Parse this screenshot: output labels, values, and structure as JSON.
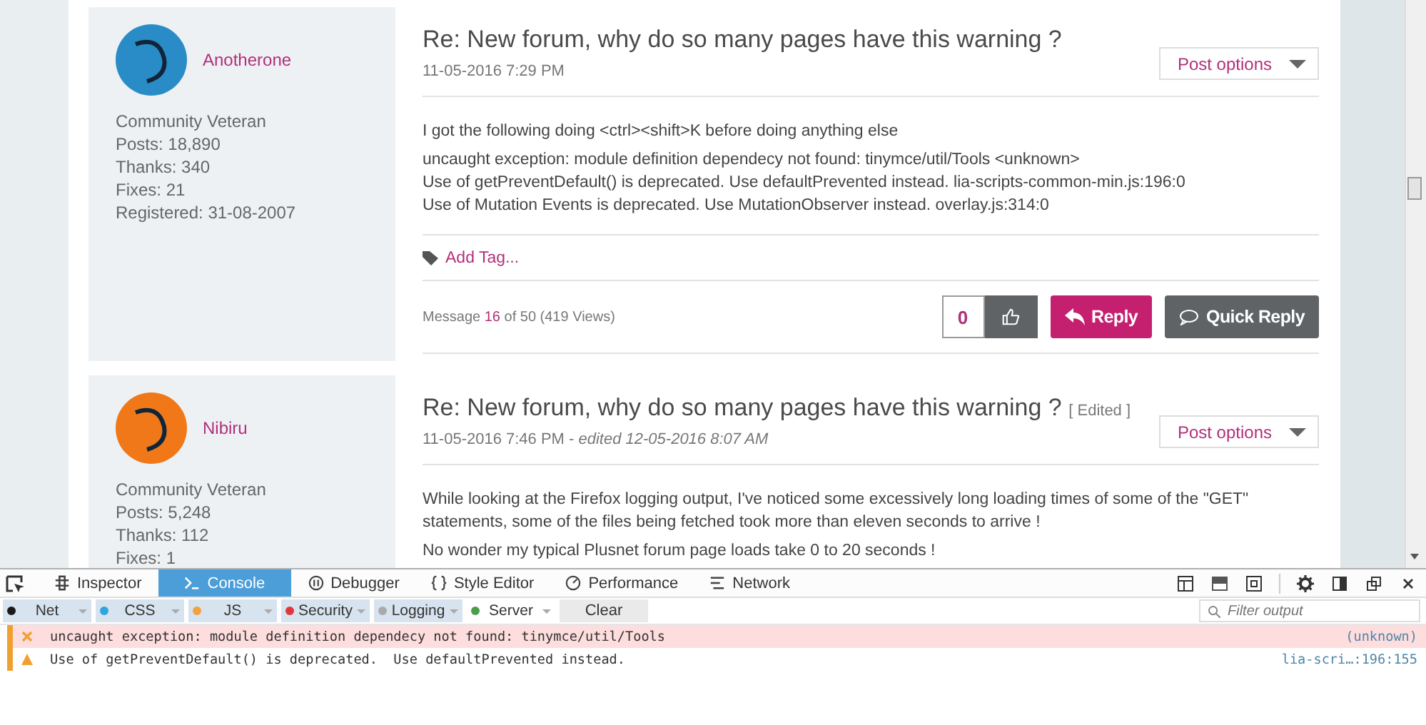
{
  "posts": [
    {
      "author": "Anotherone",
      "avatar": {
        "color": "#2a8cc6"
      },
      "rank": "Community Veteran",
      "stats": [
        "Posts: 18,890",
        "Thanks: 340",
        "Fixes: 21",
        "Registered: 31-08-2007"
      ],
      "title": "Re: New forum, why do so many pages have this warning ?",
      "date": "11-05-2016 7:29 PM",
      "options": "Post options",
      "body": [
        "I got the following doing <ctrl><shift>K before doing anything else",
        "uncaught exception: module definition dependecy not found: tinymce/util/Tools <unknown>\nUse of getPreventDefault() is deprecated. Use defaultPrevented instead. lia-scripts-common-min.js:196:0\nUse of Mutation Events is deprecated. Use MutationObserver instead. overlay.js:314:0"
      ],
      "tag_link": "Add Tag...",
      "message": {
        "prefix": "Message",
        "number": "16",
        "suffix": "of 50 (419 Views)"
      },
      "kudos": "0",
      "reply": "Reply",
      "quick_reply": "Quick Reply"
    },
    {
      "author": "Nibiru",
      "avatar": {
        "color": "#f07818"
      },
      "rank": "Community Veteran",
      "stats": [
        "Posts: 5,248",
        "Thanks: 112",
        "Fixes: 1"
      ],
      "title": "Re: New forum, why do so many pages have this warning ?",
      "edited_tag": "[ Edited ]",
      "date": "11-05-2016 7:46 PM - *edited 12-05-2016 8:07 AM*",
      "options": "Post options",
      "body": [
        "While looking at the Firefox logging output, I've noticed some excessively long loading times of some of the \"GET\" statements, some of the files being fetched took more than eleven seconds to arrive !",
        "No wonder my typical Plusnet forum page loads take 0 to 20 seconds !"
      ]
    }
  ],
  "devtools": {
    "tabs": [
      {
        "label": "Inspector",
        "selected": false
      },
      {
        "label": "Console",
        "selected": true
      },
      {
        "label": "Debugger",
        "selected": false
      },
      {
        "label": "Style Editor",
        "selected": false
      },
      {
        "label": "Performance",
        "selected": false
      },
      {
        "label": "Network",
        "selected": false
      }
    ],
    "filters": [
      {
        "label": "Net",
        "color": "#1a1a1a",
        "selected": true
      },
      {
        "label": "CSS",
        "color": "#2ba6de",
        "selected": true
      },
      {
        "label": "JS",
        "color": "#f2a23a",
        "selected": true
      },
      {
        "label": "Security",
        "color": "#e2363e",
        "selected": true
      },
      {
        "label": "Logging",
        "color": "#aaaaaa",
        "selected": true
      },
      {
        "label": "Server",
        "color": "#4b9e4b",
        "selected": false
      }
    ],
    "clear": "Clear",
    "filter_placeholder": "Filter output",
    "messages": [
      {
        "kind": "error",
        "text": "uncaught exception: module definition dependecy not found: tinymce/util/Tools",
        "source": "(unknown)"
      },
      {
        "kind": "warning",
        "text": "Use of getPreventDefault() is deprecated.  Use defaultPrevented instead.",
        "source": "lia-scri…:196:155"
      }
    ]
  }
}
